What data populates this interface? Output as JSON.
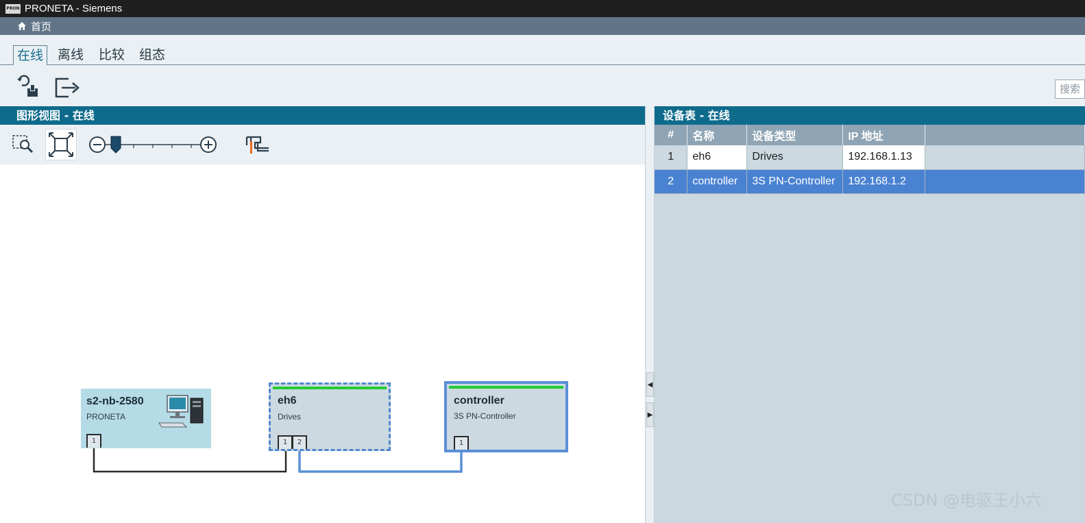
{
  "app": {
    "title": "PRONETA - Siemens",
    "logo_text": "PRON"
  },
  "homebar": {
    "home_label": "首页"
  },
  "tabs": [
    {
      "label": "在线",
      "active": true
    },
    {
      "label": "离线",
      "active": false
    },
    {
      "label": "比较",
      "active": false
    },
    {
      "label": "组态",
      "active": false
    }
  ],
  "toolbar": {
    "refresh_icon": "refresh-network-icon",
    "export_icon": "export-icon",
    "search_placeholder": "搜索"
  },
  "graphic_view": {
    "header": "图形视图 - 在线",
    "zoom_area_icon": "zoom-area-icon",
    "fit_icon": "fit-to-view-icon",
    "zoom_level": 0.05,
    "layout_icon": "topology-layout-icon"
  },
  "device_table": {
    "header": "设备表 - 在线",
    "columns": [
      "#",
      "名称",
      "设备类型",
      "IP 地址"
    ],
    "rows": [
      {
        "num": "1",
        "name": "eh6",
        "type": "Drives",
        "ip": "192.168.1.13",
        "selected": false
      },
      {
        "num": "2",
        "name": "controller",
        "type": "3S PN-Controller",
        "ip": "192.168.1.2",
        "selected": true
      }
    ]
  },
  "topology": {
    "nodes": [
      {
        "name": "s2-nb-2580",
        "type": "PRONETA",
        "ports": [
          "1"
        ]
      },
      {
        "name": "eh6",
        "type": "Drives",
        "ports": [
          "1",
          "2"
        ]
      },
      {
        "name": "controller",
        "type": "3S PN-Controller",
        "ports": [
          "1"
        ]
      }
    ]
  },
  "colors": {
    "header_blue": "#0f6b8c",
    "selection_blue": "#4a82d2",
    "status_green": "#22cc33",
    "link_blue": "#5b8fd6"
  },
  "watermark": "CSDN @电驱王小六"
}
